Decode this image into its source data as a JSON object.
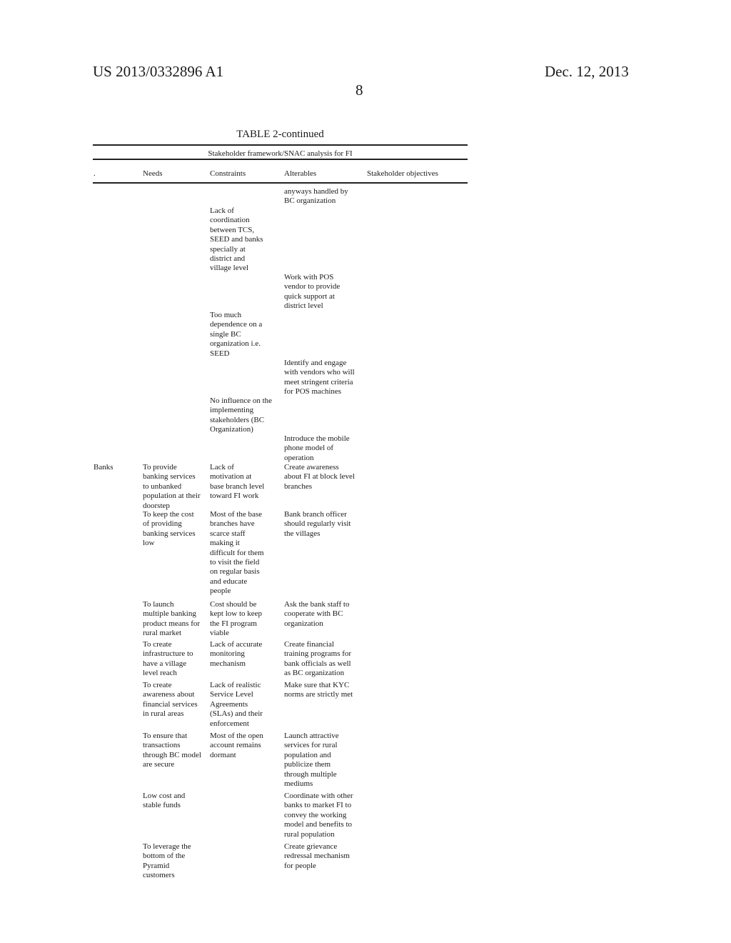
{
  "header": {
    "publication_number": "US 2013/0332896 A1",
    "date": "Dec. 12, 2013",
    "page_number": "8"
  },
  "table": {
    "title": "TABLE 2-continued",
    "subtitle": "Stakeholder framework/SNAC analysis for FI",
    "columns": [
      ".",
      "Needs",
      "Constraints",
      "Alterables",
      "Stakeholder objectives"
    ],
    "cells": {
      "alt_0": "anyways handled by\nBC organization",
      "con_0": "Lack of\ncoordination\nbetween TCS,\nSEED and banks\nspecially at\ndistrict and\nvillage level",
      "alt_1": "Work with POS\nvendor to provide\nquick support at\ndistrict level",
      "con_1": "Too much\ndependence on a\nsingle BC\norganization i.e.\nSEED",
      "alt_2": "Identify and engage\nwith vendors who will\nmeet stringent criteria\nfor POS machines",
      "con_2": "No influence on the\nimplementing\nstakeholders (BC\nOrganization)",
      "alt_3": "Introduce the mobile\nphone model of\noperation",
      "stakeholder_banks": "Banks",
      "need_0": "To provide\nbanking services\nto unbanked\npopulation at their\ndoorstep",
      "con_3": "Lack of\nmotivation at\nbase branch level\ntoward FI work",
      "alt_4": "Create awareness\nabout FI at block level\nbranches",
      "need_1": "To keep the cost\nof providing\nbanking services\nlow",
      "con_4": "Most of the base\nbranches have\nscarce staff\nmaking it\ndifficult for them\nto visit the field\non regular basis\nand educate\npeople",
      "alt_5": "Bank branch officer\nshould regularly visit\nthe villages",
      "need_2": "To launch\nmultiple banking\nproduct means for\nrural market",
      "con_5": "Cost should be\nkept low to keep\nthe FI program\nviable",
      "alt_6": "Ask the bank staff to\ncooperate with BC\norganization",
      "need_3": "To create\ninfrastructure to\nhave a village\nlevel reach",
      "con_6": "Lack of accurate\nmonitoring\nmechanism",
      "alt_7": "Create financial\ntraining programs for\nbank officials as well\nas BC organization",
      "need_4": "To create\nawareness about\nfinancial services\nin rural areas",
      "con_7": "Lack of realistic\nService Level\nAgreements\n(SLAs) and their\nenforcement",
      "alt_8": "Make sure that KYC\nnorms are strictly met",
      "need_5": "To ensure that\ntransactions\nthrough BC model\nare secure",
      "con_8": "Most of the open\naccount remains\ndormant",
      "alt_9": "Launch attractive\nservices for rural\npopulation and\npublicize them\nthrough multiple\nmediums",
      "need_6": "Low cost and\nstable funds",
      "alt_10": "Coordinate with other\nbanks to market FI to\nconvey the working\nmodel and benefits to\nrural population",
      "need_7": "To leverage the\nbottom of the\nPyramid\ncustomers",
      "alt_11": "Create grievance\nredressal mechanism\nfor people"
    }
  }
}
